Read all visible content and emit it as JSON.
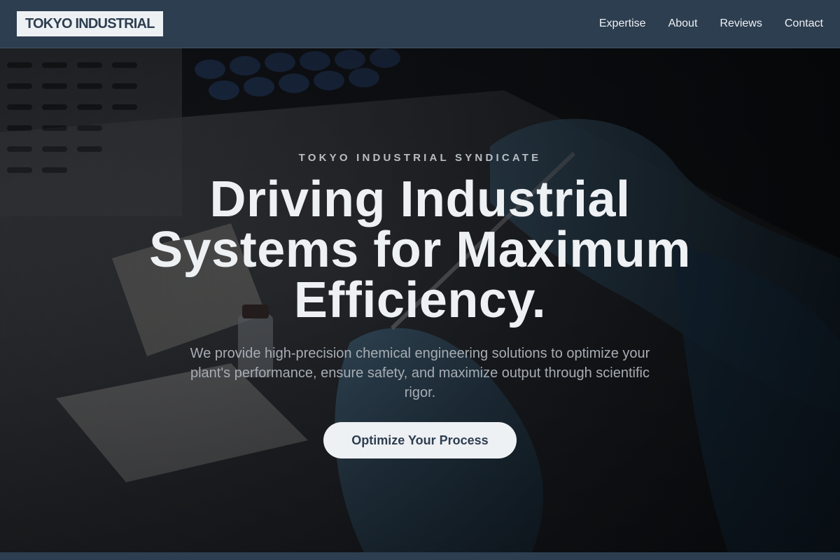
{
  "header": {
    "logo": "TOKYO INDUSTRIAL",
    "nav": [
      "Expertise",
      "About",
      "Reviews",
      "Contact"
    ]
  },
  "hero": {
    "eyebrow": "TOKYO INDUSTRIAL SYNDICATE",
    "headline": "Driving Industrial Systems for Maximum Efficiency.",
    "subtext": "We provide high-precision chemical engineering solutions to optimize your plant's performance, ensure safety, and maximize output through scientific rigor.",
    "cta_label": "Optimize Your Process",
    "background_image": "lab-gloved-hands-syringe-photo"
  },
  "colors": {
    "header_bg": "#2d3e50",
    "text_light": "#eef1f4",
    "muted_text": "#a7adb4",
    "glove_blue": "#3f6f8f"
  }
}
